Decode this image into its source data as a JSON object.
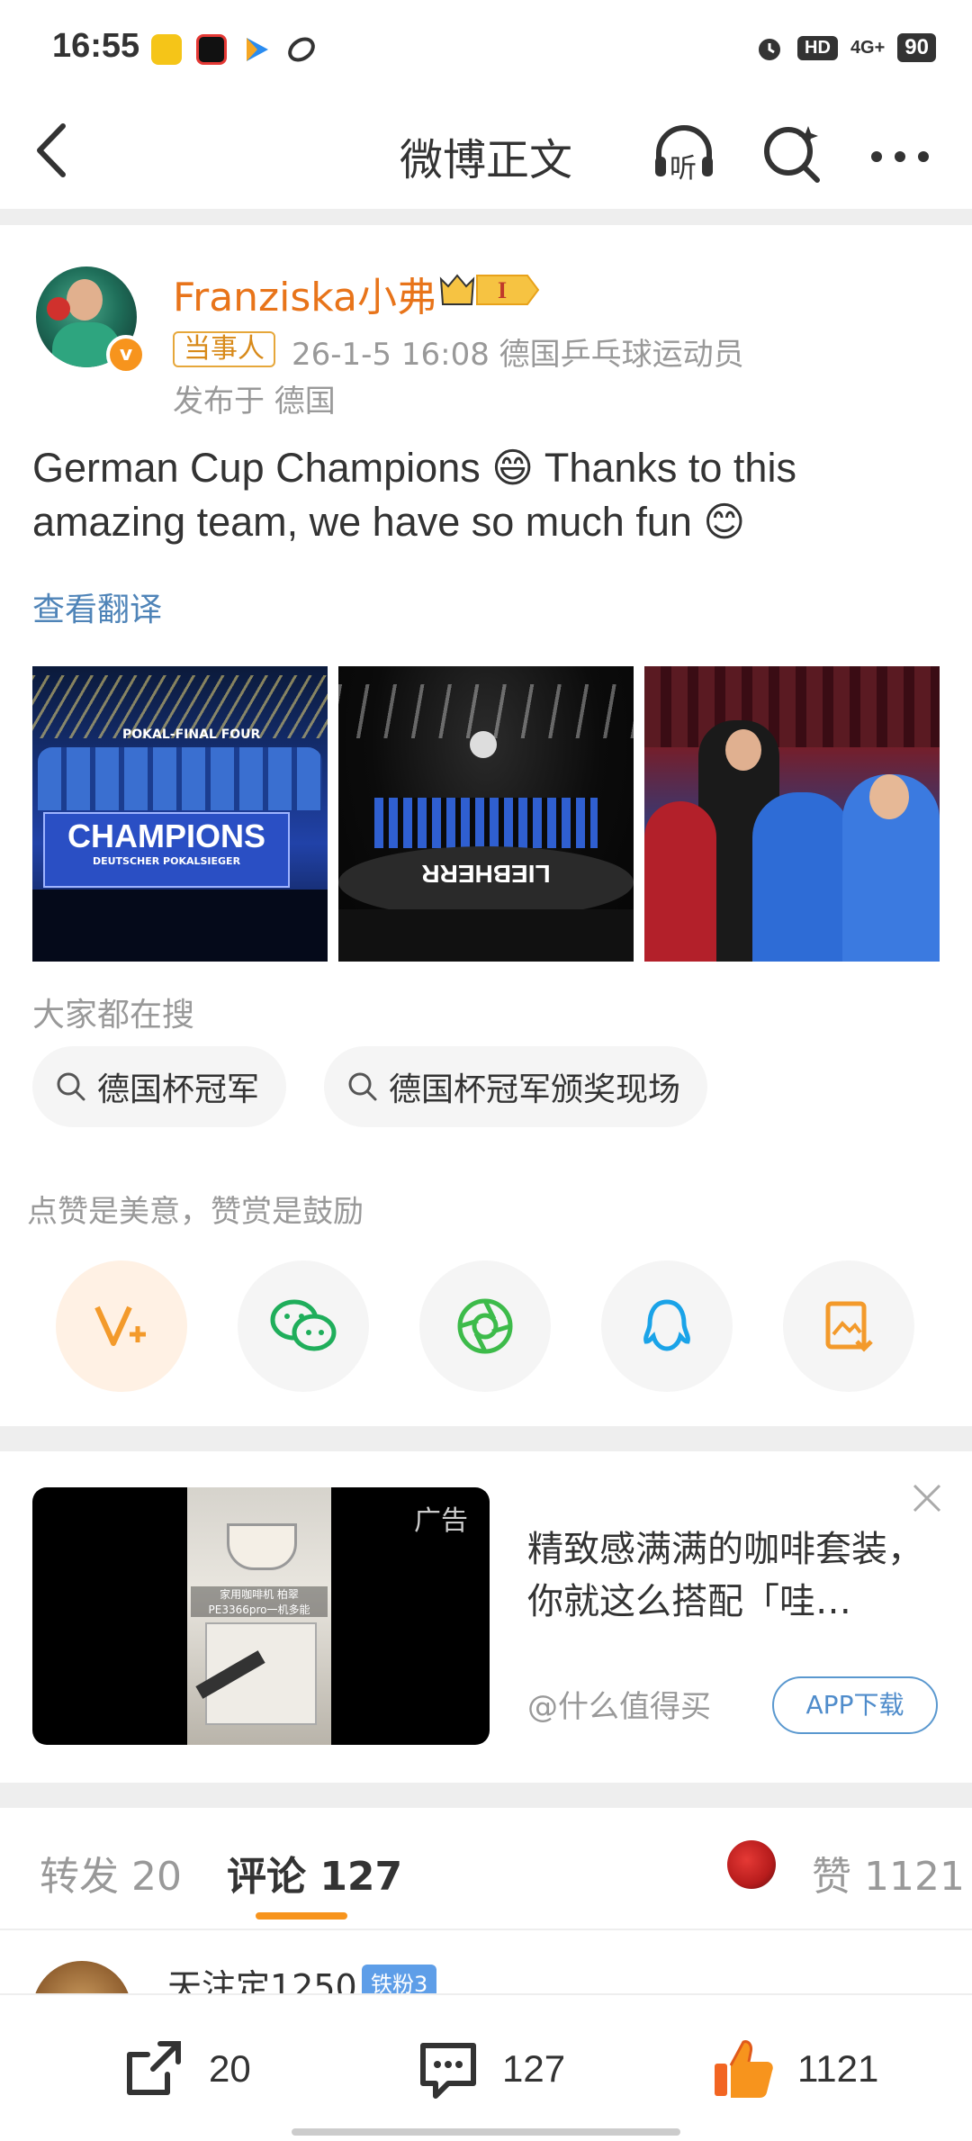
{
  "status_bar": {
    "time": "16:55",
    "signal_label": "4G+",
    "hd_label": "HD",
    "battery": "90"
  },
  "nav": {
    "title": "微博正文",
    "listen_label": "听"
  },
  "post": {
    "author": "Franziska小弗",
    "level_badge": "I",
    "role_badge": "当事人",
    "meta": "26-1-5 16:08  德国乒乓球运动员",
    "location": "发布于 德国",
    "text": "German Cup Champions 😄 Thanks to this amazing team, we have so much fun 😊",
    "translate": "查看翻译",
    "images": [
      {
        "caption": "CHAMPIONS",
        "sub": "DEUTSCHER POKALSIEGER",
        "banner": "POKAL-FINAL FOUR"
      },
      {
        "caption": "LIEBHERR"
      },
      {
        "caption": ""
      }
    ]
  },
  "search": {
    "heading": "大家都在搜",
    "chips": [
      "德国杯冠军",
      "德国杯冠军颁奖现场"
    ]
  },
  "reward": {
    "text": "点赞是美意，赞赏是鼓励",
    "share_targets": [
      "v-plus-icon",
      "wechat-icon",
      "moments-icon",
      "qq-icon",
      "save-image-icon"
    ]
  },
  "ad": {
    "label": "广告",
    "title": "精致感满满的咖啡套装，你就这么搭配「哇…",
    "source": "@什么值得买",
    "button": "APP下载",
    "image_caption": "家用咖啡机 柏翠PE3366pro一机多能"
  },
  "tabs": {
    "repost": "转发 20",
    "comment": "评论 127",
    "likes": "赞 1121"
  },
  "comment_preview": {
    "name": "天注定1250",
    "badge": "铁粉3"
  },
  "bottom_bar": {
    "repost": "20",
    "comment": "127",
    "like": "1121"
  },
  "colors": {
    "accent": "#f7941d",
    "author": "#e8741a",
    "link": "#4f84b8",
    "bg_gray": "#eeeeee"
  }
}
